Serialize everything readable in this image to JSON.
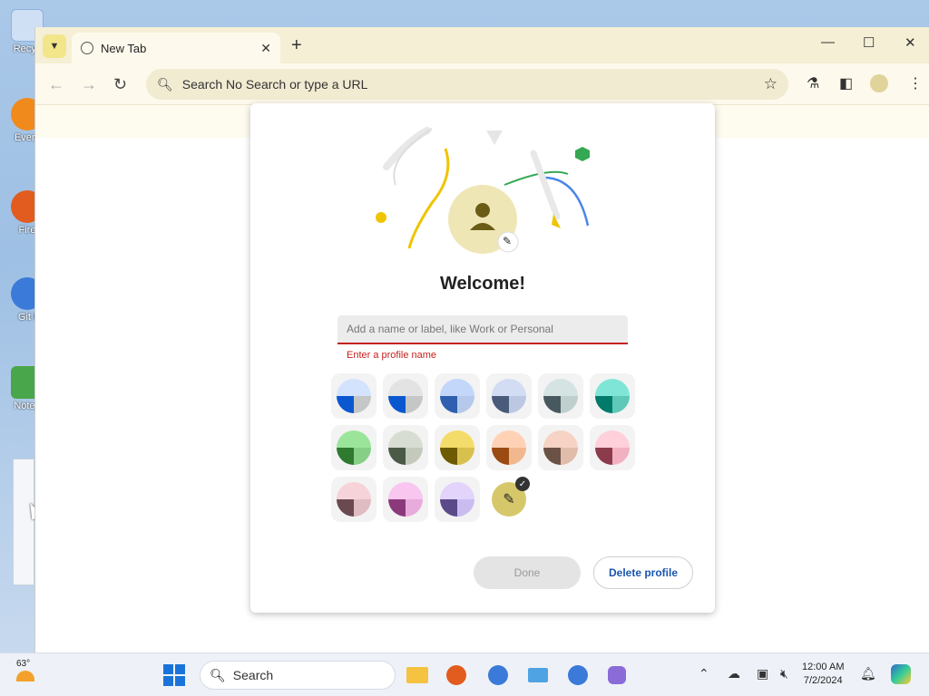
{
  "desktop": {
    "icons": [
      {
        "label": "Recyc",
        "color": "#3a7bd5"
      },
      {
        "label": "Every",
        "color": "#f08a1c"
      },
      {
        "label": "Fire",
        "color": "#e25c1f"
      },
      {
        "label": "Git I",
        "color": "#3b7ad8"
      },
      {
        "label": "Notep",
        "color": "#4aa64a"
      }
    ]
  },
  "browser": {
    "tab_title": "New Tab",
    "omnibox_text": "Search No Search or type a URL"
  },
  "dialog": {
    "welcome": "Welcome!",
    "name_placeholder": "Add a name or label, like Work or Personal",
    "name_value": "",
    "error": "Enter a profile name",
    "done_label": "Done",
    "delete_label": "Delete profile",
    "colors": [
      {
        "top": "#d3e3fd",
        "bl": "#0b57d0",
        "br": "#c4c7c5"
      },
      {
        "top": "#e3e3e3",
        "bl": "#0b57d0",
        "br": "#c4c7c5"
      },
      {
        "top": "#c2d7fa",
        "bl": "#2f5fae",
        "br": "#b6c9ea"
      },
      {
        "top": "#d2dcf3",
        "bl": "#4a5a7a",
        "br": "#bcc8e2"
      },
      {
        "top": "#d5e4e2",
        "bl": "#47585e",
        "br": "#bfcfcd"
      },
      {
        "top": "#7fe6d7",
        "bl": "#007a6a",
        "br": "#5fc8b8"
      },
      {
        "top": "#9be59b",
        "bl": "#2f7a2f",
        "br": "#86cf86"
      },
      {
        "top": "#d7ddd2",
        "bl": "#4a5a47",
        "br": "#c3cabc"
      },
      {
        "top": "#f4dc6a",
        "bl": "#6e5a00",
        "br": "#d8c04e"
      },
      {
        "top": "#ffd2b6",
        "bl": "#9b4a12",
        "br": "#f1b890"
      },
      {
        "top": "#f6d3c4",
        "bl": "#6b5246",
        "br": "#e2bcab"
      },
      {
        "top": "#ffcfda",
        "bl": "#8c3b4c",
        "br": "#f2b1c0"
      },
      {
        "top": "#f5d3d9",
        "bl": "#6a4a50",
        "br": "#dfbcc2"
      },
      {
        "top": "#f8c6ef",
        "bl": "#8a3a7a",
        "br": "#e8acdc"
      },
      {
        "top": "#e2d4fb",
        "bl": "#5a4a8a",
        "br": "#cbbcf0"
      }
    ],
    "custom_color": "#d6c86a"
  },
  "taskbar": {
    "temperature": "63°",
    "search_label": "Search",
    "time": "12:00 AM",
    "date": "7/2/2024"
  }
}
